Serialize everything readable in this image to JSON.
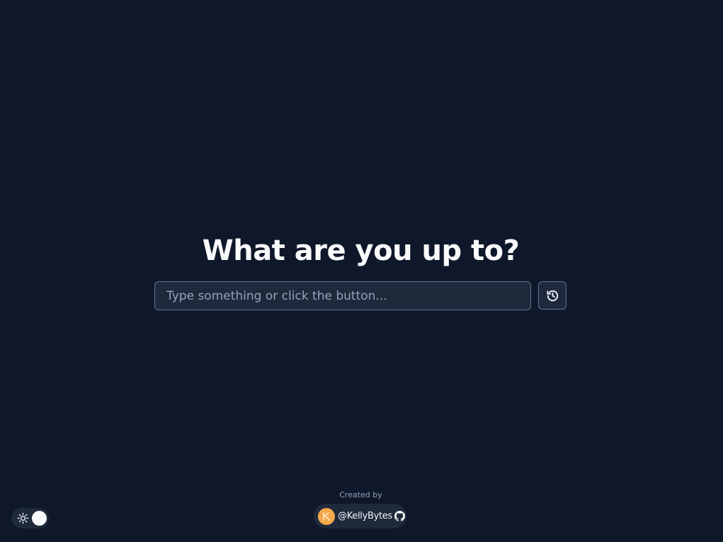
{
  "main": {
    "headline": "What are you up to?",
    "search": {
      "value": "",
      "placeholder": "Type something or click the button..."
    },
    "history_button": {
      "icon": "history-icon"
    }
  },
  "footer": {
    "created_by": "Created by",
    "creator_handle": "@KellyBytes",
    "avatar_icon": "avatar",
    "github_icon": "github-icon"
  },
  "theme_toggle": {
    "icon": "sun-icon",
    "state": "off"
  },
  "colors": {
    "background": "#0f172a",
    "surface": "#1e293b",
    "border": "#64748b",
    "text": "#f8fafc",
    "muted": "#94a3b8",
    "avatar": "#f5a84a"
  }
}
